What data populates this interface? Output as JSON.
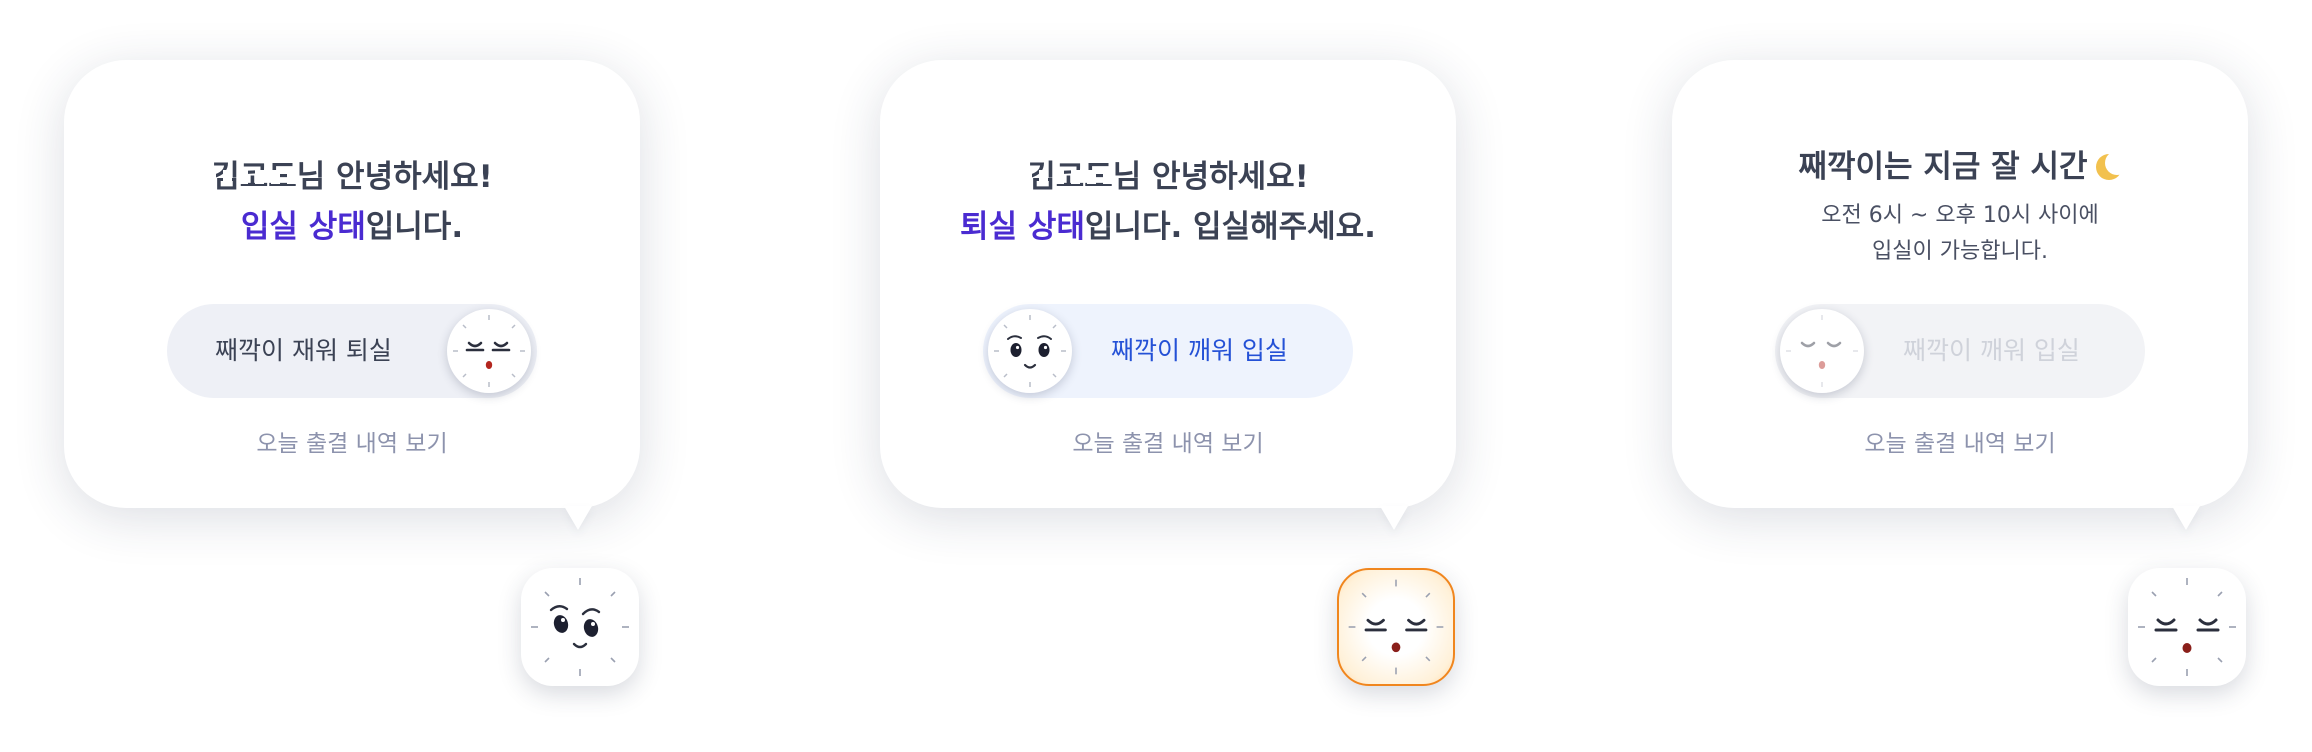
{
  "cards": [
    {
      "name_masked": "김코드",
      "greeting_suffix": "님 안녕하세요!",
      "status_highlight": "입실 상태",
      "status_suffix": "입니다.",
      "toggle_label": "째깍이 재워 퇴실",
      "history_link": "오늘 출결 내역 보기"
    },
    {
      "name_masked": "김코드",
      "greeting_suffix": "님 안녕하세요!",
      "status_highlight": "퇴실 상태",
      "status_suffix": "입니다. 입실해주세요.",
      "toggle_label": "째깍이 깨워 입실",
      "history_link": "오늘 출결 내역 보기"
    },
    {
      "title": "째깍이는 지금 잘 시간",
      "subtitle_line1": "오전 6시 ~ 오후 10시 사이에",
      "subtitle_line2": "입실이 가능합니다.",
      "toggle_label": "째깍이 깨워 입실",
      "history_link": "오늘 출결 내역 보기"
    }
  ],
  "colors": {
    "highlight": "#4a2bd1",
    "link_blue": "#2451d6",
    "muted": "#8d93ad",
    "badge_border_orange": "#f0861e"
  },
  "icons": [
    "clock-face-sleeping-icon",
    "clock-face-awake-icon",
    "moon-icon"
  ]
}
